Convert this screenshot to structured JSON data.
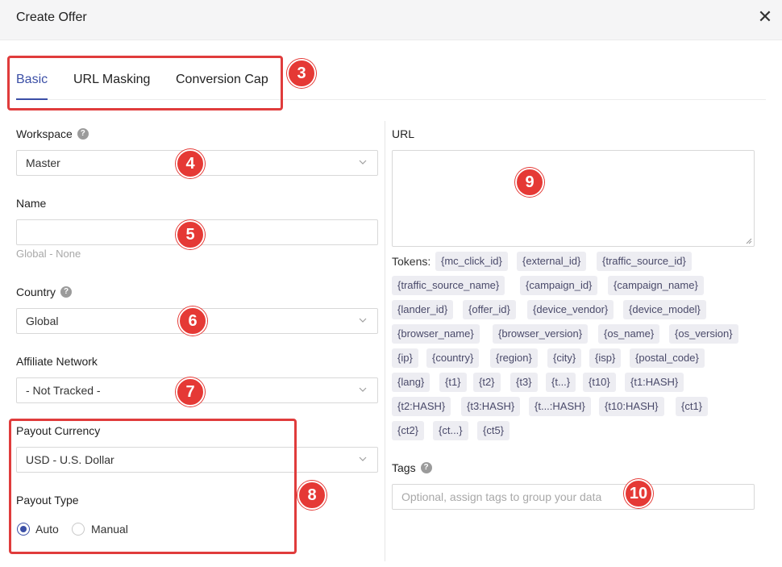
{
  "header": {
    "title": "Create Offer",
    "close_symbol": "✕"
  },
  "tabs": [
    {
      "label": "Basic",
      "active": true
    },
    {
      "label": "URL Masking",
      "active": false
    },
    {
      "label": "Conversion Cap",
      "active": false
    }
  ],
  "form": {
    "workspace": {
      "label": "Workspace",
      "value": "Master"
    },
    "name": {
      "label": "Name",
      "value": "",
      "hint": "Global - None"
    },
    "country": {
      "label": "Country",
      "value": "Global"
    },
    "affiliate_network": {
      "label": "Affiliate Network",
      "value": "- Not Tracked -"
    },
    "payout_currency": {
      "label": "Payout Currency",
      "value": "USD - U.S. Dollar"
    },
    "payout_type": {
      "label": "Payout Type",
      "options": [
        {
          "label": "Auto",
          "checked": true
        },
        {
          "label": "Manual",
          "checked": false
        }
      ]
    },
    "url": {
      "label": "URL",
      "value": ""
    },
    "tokens_label": "Tokens:",
    "tokens": [
      "{mc_click_id}",
      "{external_id}",
      "{traffic_source_id}",
      "{traffic_source_name}",
      "{campaign_id}",
      "{campaign_name}",
      "{lander_id}",
      "{offer_id}",
      "{device_vendor}",
      "{device_model}",
      "{browser_name}",
      "{browser_version}",
      "{os_name}",
      "{os_version}",
      "{ip}",
      "{country}",
      "{region}",
      "{city}",
      "{isp}",
      "{postal_code}",
      "{lang}",
      "{t1}",
      "{t2}",
      "{t3}",
      "{t...}",
      "{t10}",
      "{t1:HASH}",
      "{t2:HASH}",
      "{t3:HASH}",
      "{t...:HASH}",
      "{t10:HASH}",
      "{ct1}",
      "{ct2}",
      "{ct...}",
      "{ct5}"
    ],
    "tags": {
      "label": "Tags",
      "placeholder": "Optional, assign tags to group your data"
    }
  },
  "annotations": [
    "3",
    "4",
    "5",
    "6",
    "7",
    "8",
    "9",
    "10"
  ],
  "colors": {
    "accent": "#3b4fa6",
    "annotation_red": "#e53935"
  },
  "icons": {
    "help": "help-circle-icon",
    "dropdown": "chevron-down-icon",
    "close": "close-icon"
  }
}
